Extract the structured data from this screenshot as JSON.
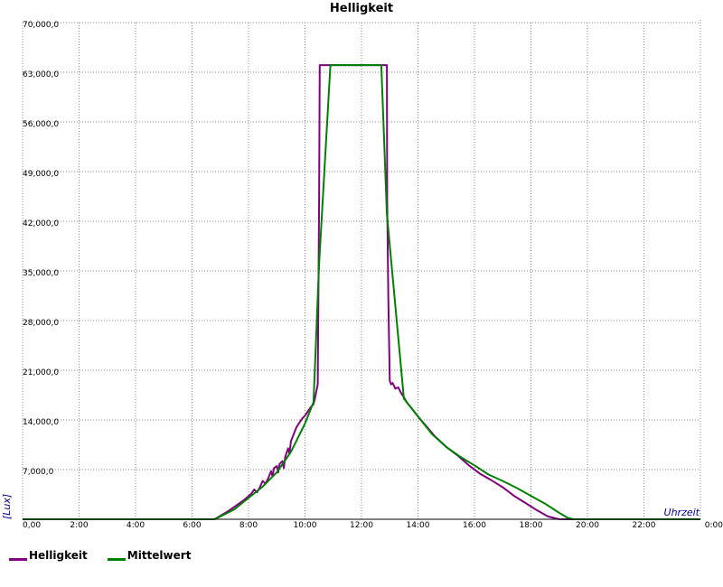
{
  "chart_data": {
    "type": "line",
    "title": "Helligkeit",
    "xlabel": "Uhrzeit",
    "ylabel": "[Lux]",
    "xlim": [
      0,
      24
    ],
    "ylim": [
      0,
      70000
    ],
    "grid": true,
    "legend_position": "bottom-left",
    "x_ticks": [
      "0,00",
      "2:00",
      "4:00",
      "6:00",
      "8:00",
      "10:00",
      "12:00",
      "14:00",
      "16:00",
      "18:00",
      "20:00",
      "22:00",
      "0:00"
    ],
    "y_ticks": [
      "",
      "7,000,0",
      "14,000,0",
      "21,000,0",
      "28,000,0",
      "35,000,0",
      "42,000,0",
      "49,000,0",
      "56,000,0",
      "63,000,0",
      "70,000,0"
    ],
    "series": [
      {
        "name": "Helligkeit",
        "color": "#800080",
        "x": [
          0,
          6.8,
          7.3,
          7.8,
          8.1,
          8.2,
          8.3,
          8.4,
          8.5,
          8.6,
          8.7,
          8.8,
          8.85,
          8.9,
          9.0,
          9.05,
          9.1,
          9.2,
          9.25,
          9.3,
          9.4,
          9.45,
          9.5,
          9.6,
          9.7,
          9.8,
          9.9,
          10.0,
          10.1,
          10.2,
          10.3,
          10.35,
          10.4,
          10.45,
          10.5,
          10.52,
          10.53,
          12.9,
          12.91,
          12.95,
          13.0,
          13.05,
          13.1,
          13.2,
          13.3,
          13.4,
          13.5,
          13.6,
          13.8,
          14.0,
          14.3,
          14.6,
          15.0,
          15.4,
          15.8,
          16.2,
          16.6,
          17.0,
          17.4,
          17.8,
          18.2,
          18.6,
          19.0,
          19.3,
          19.5,
          24
        ],
        "y": [
          0,
          0,
          1200,
          2600,
          3600,
          4200,
          3800,
          4500,
          5400,
          5000,
          5800,
          6800,
          6000,
          7200,
          7500,
          6600,
          7800,
          8200,
          7200,
          8800,
          10000,
          9200,
          11000,
          12000,
          13000,
          13600,
          14200,
          14600,
          15200,
          15800,
          16200,
          17000,
          18000,
          19000,
          45000,
          64000,
          64000,
          64000,
          45000,
          31000,
          19500,
          19000,
          19200,
          18400,
          18600,
          17800,
          17200,
          16500,
          15500,
          14500,
          13100,
          11700,
          10200,
          9000,
          7600,
          6400,
          5500,
          4500,
          3300,
          2300,
          1300,
          400,
          0,
          0,
          0,
          0
        ]
      },
      {
        "name": "Mittelwert",
        "color": "#008000",
        "x": [
          0,
          6.8,
          7.5,
          8.0,
          8.5,
          9.0,
          9.5,
          10.0,
          10.3,
          10.5,
          10.9,
          11.0,
          12.7,
          12.9,
          13.2,
          13.5,
          14.0,
          14.5,
          15.0,
          15.5,
          16.0,
          16.5,
          17.0,
          17.5,
          18.0,
          18.5,
          19.0,
          19.3,
          19.5,
          24
        ],
        "y": [
          0,
          0,
          1400,
          3000,
          4600,
          6600,
          9500,
          13500,
          16500,
          36000,
          64000,
          64000,
          64000,
          43000,
          30000,
          17000,
          14500,
          12000,
          10200,
          8800,
          7600,
          6300,
          5400,
          4400,
          3300,
          2200,
          900,
          200,
          0,
          0
        ]
      }
    ]
  }
}
